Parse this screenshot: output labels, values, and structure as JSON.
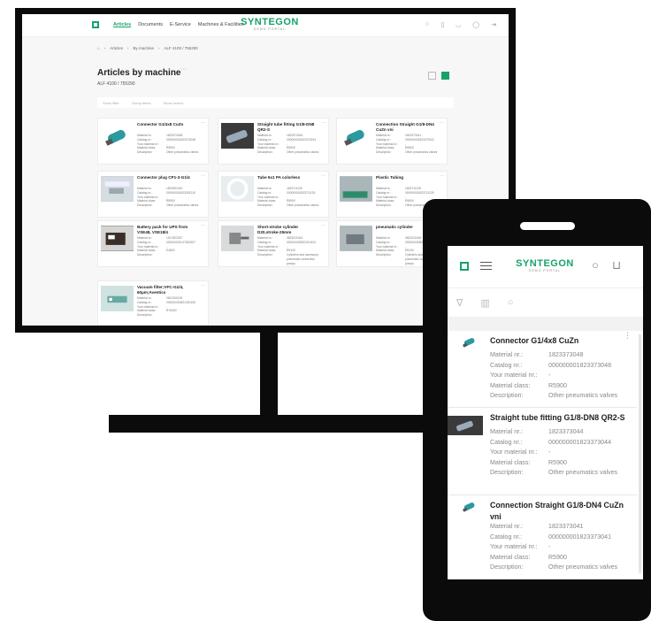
{
  "brand": {
    "name": "SYNTEGON",
    "sub": "DEMO PORTAL"
  },
  "desktop": {
    "nav": [
      "Articles",
      "Documents",
      "E-Service",
      "Machines & Facilities"
    ],
    "breadcrumb": [
      "Articles",
      "By machine",
      "ALF 4100 / 755290"
    ],
    "title": "Articles by machine",
    "subtitle": "ALF 4100 / 755290",
    "filters": [
      "Show filter",
      "Group items",
      "Show search"
    ],
    "labels": [
      "Material nr.:",
      "Catalog nr.:",
      "Your material nr.:",
      "Material class:",
      "Description:"
    ],
    "cards": [
      {
        "title": "Connector G1/4x8 CuZn",
        "material": "1823373048",
        "catalog": "000000001823373048",
        "yours": "-",
        "class": "R5900",
        "desc": "Other pneumatics valves"
      },
      {
        "title": "Straight tube fitting G1/8-DN8 QR2-S",
        "material": "1823373044",
        "catalog": "000000001823373044",
        "yours": "-",
        "class": "R5900",
        "desc": "Other pneumatics valves"
      },
      {
        "title": "Connection Straight G1/8-DN4 CuZn vni",
        "material": "1823373041",
        "catalog": "000000001823373041",
        "yours": "-",
        "class": "R5900",
        "desc": "Other pneumatics valves"
      },
      {
        "title": "Connector plug CP1-3-G1/4",
        "material": "1823351310",
        "catalog": "000000001823351310",
        "yours": "-",
        "class": "R5900",
        "desc": "Other pneumatics valves"
      },
      {
        "title": "Tube 6x1 PA colorless",
        "material": "1823711130",
        "catalog": "000000001823711130",
        "yours": "-",
        "class": "R5900",
        "desc": "Other pneumatics valves"
      },
      {
        "title": "Plastic Tubing",
        "material": "1823711125",
        "catalog": "000000001823711125",
        "yours": "-",
        "class": "R5900",
        "desc": "Other pneumatics valves"
      },
      {
        "title": "Battery pack for UPS from VSE48, VSE18/4",
        "material": "1017802307",
        "catalog": "000000001017802307",
        "yours": "-",
        "class": "E4800",
        "desc": ""
      },
      {
        "title": "Short-stroke cylinder D20,stroke-25mm",
        "material": "0822010424",
        "catalog": "000000000822010424",
        "yours": "-",
        "class": "R5100",
        "desc": "Cylinders and accessory pneumatic connection pumps"
      },
      {
        "title": "pneumatic cylinder",
        "material": "0822010426",
        "catalog": "000000000822010426",
        "yours": "-",
        "class": "R5100",
        "desc": "Cylinders and accessory pneumatic connection pumps"
      },
      {
        "title": "Vacuum filter;VFC-G1/4, 60µm;Aventics",
        "material": "0821300190",
        "catalog": "000000000821300190",
        "yours": "-",
        "class": "R75400",
        "desc": ""
      }
    ]
  },
  "mobile": {
    "labels": [
      "Material nr.:",
      "Catalog nr.:",
      "Your material nr.:",
      "Material class:",
      "Description:"
    ],
    "cards": [
      {
        "title": "Connector G1/4x8 CuZn",
        "material": "1823373048",
        "catalog": "000000001823373048",
        "yours": "-",
        "class": "R5900",
        "desc": "Other pneumatics valves"
      },
      {
        "title": "Straight tube fitting G1/8-DN8 QR2-S",
        "material": "1823373044",
        "catalog": "000000001823373044",
        "yours": "-",
        "class": "R5900",
        "desc": "Other pneumatics valves"
      },
      {
        "title": "Connection Straight G1/8-DN4 CuZn vni",
        "material": "1823373041",
        "catalog": "000000001823373041",
        "yours": "-",
        "class": "R5900",
        "desc": "Other pneumatics valves"
      }
    ]
  },
  "colors": {
    "accent": "#16a36a",
    "frame": "#0b0b0b"
  }
}
